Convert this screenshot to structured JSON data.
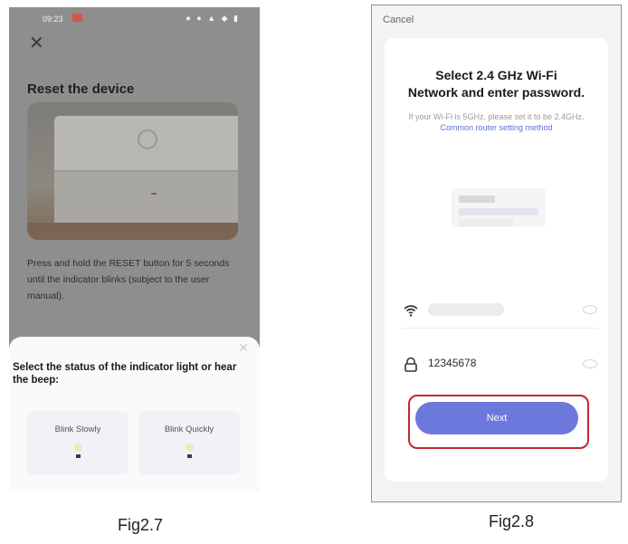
{
  "fig27": {
    "status_time": "09:23",
    "title": "Reset the device",
    "description": "Press and hold the RESET button for 5 seconds until the indicator blinks (subject to the user manual).",
    "sheet_title": "Select the status of the indicator light or hear the beep:",
    "option_slow": "Blink Slowly",
    "option_quick": "Blink Quickly",
    "caption": "Fig2.7"
  },
  "fig28": {
    "cancel": "Cancel",
    "title_line1": "Select 2.4 GHz Wi-Fi",
    "title_line2": "Network and enter password.",
    "hint": "If your Wi-Fi is 5GHz, please set it to be 2.4GHz.",
    "hint_link": "Common router setting method",
    "password": "12345678",
    "next_label": "Next",
    "caption": "Fig2.8"
  },
  "icons": {
    "close": "close-icon",
    "wifi": "wifi-icon",
    "lock": "lock-icon",
    "eye": "eye-icon"
  },
  "colors": {
    "overlay": "#8e8e8e",
    "next_button": "#6d78dd",
    "highlight": "#c0282d",
    "link": "#5b6fd8"
  }
}
